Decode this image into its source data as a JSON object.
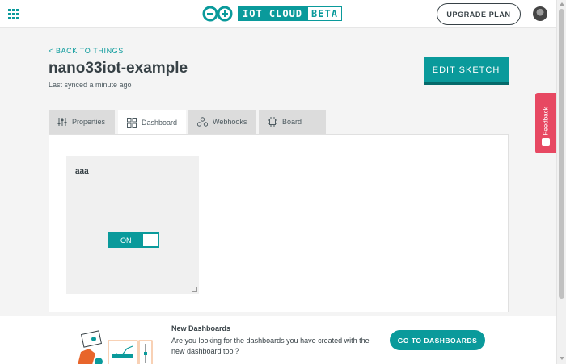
{
  "header": {
    "brand": "IOT CLOUD",
    "badge": "BETA",
    "upgrade_label": "UPGRADE PLAN"
  },
  "thing": {
    "back_label": "< BACK TO THINGS",
    "title": "nano33iot-example",
    "last_synced": "Last synced a minute ago",
    "edit_sketch_label": "EDIT SKETCH"
  },
  "feedback": {
    "label": "Feedback"
  },
  "tabs": [
    {
      "label": "Properties",
      "icon": "sliders-icon"
    },
    {
      "label": "Dashboard",
      "icon": "dashboard-grid-icon",
      "active": true
    },
    {
      "label": "Webhooks",
      "icon": "webhooks-icon"
    },
    {
      "label": "Board",
      "icon": "chip-icon"
    }
  ],
  "dashboard": {
    "widget": {
      "name": "aaa",
      "toggle_label": "ON"
    }
  },
  "banner": {
    "title": "New Dashboards",
    "text": "Are you looking for the dashboards you have created with the new dashboard tool?",
    "button_label": "GO TO DASHBOARDS"
  },
  "colors": {
    "accent": "#0a9a9b",
    "feedback": "#e74862",
    "text": "#374146"
  }
}
